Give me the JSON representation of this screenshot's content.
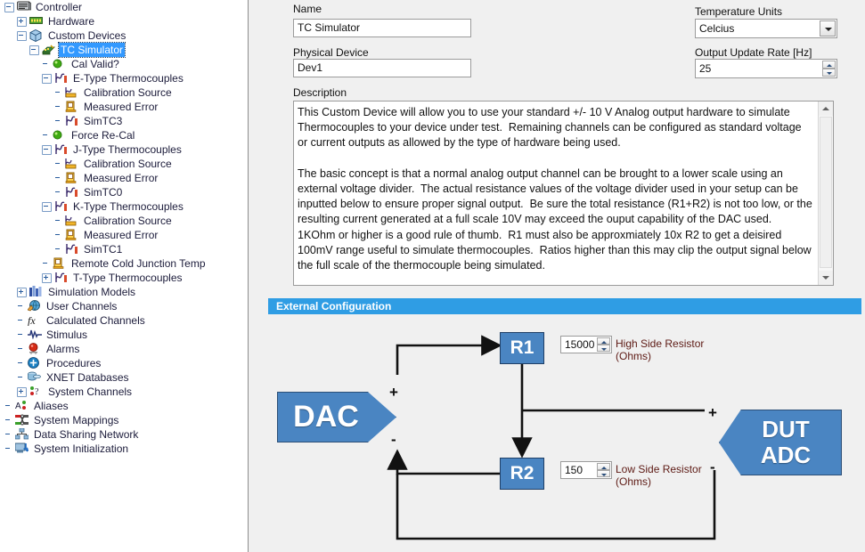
{
  "tree": {
    "items": [
      {
        "label": "Controller",
        "depth": 0,
        "toggle": "minus",
        "icon": "controller-icon",
        "selected": false
      },
      {
        "label": "Hardware",
        "depth": 1,
        "toggle": "plus",
        "icon": "hardware-icon",
        "selected": false
      },
      {
        "label": "Custom Devices",
        "depth": 1,
        "toggle": "minus",
        "icon": "custom-devices-icon",
        "selected": false
      },
      {
        "label": "TC Simulator",
        "depth": 2,
        "toggle": "minus",
        "icon": "tc-simulator-icon",
        "selected": true
      },
      {
        "label": "Cal Valid?",
        "depth": 3,
        "toggle": "none",
        "icon": "green-led-icon",
        "selected": false
      },
      {
        "label": "E-Type Thermocouples",
        "depth": 3,
        "toggle": "minus",
        "icon": "waveform-icon",
        "selected": false
      },
      {
        "label": "Calibration Source",
        "depth": 4,
        "toggle": "none",
        "icon": "calibration-source-icon",
        "selected": false
      },
      {
        "label": "Measured Error",
        "depth": 4,
        "toggle": "none",
        "icon": "measured-error-icon",
        "selected": false
      },
      {
        "label": "SimTC3",
        "depth": 4,
        "toggle": "none",
        "icon": "waveform-icon",
        "selected": false
      },
      {
        "label": "Force Re-Cal",
        "depth": 3,
        "toggle": "none",
        "icon": "green-led-icon",
        "selected": false
      },
      {
        "label": "J-Type Thermocouples",
        "depth": 3,
        "toggle": "minus",
        "icon": "waveform-icon",
        "selected": false
      },
      {
        "label": "Calibration Source",
        "depth": 4,
        "toggle": "none",
        "icon": "calibration-source-icon",
        "selected": false
      },
      {
        "label": "Measured Error",
        "depth": 4,
        "toggle": "none",
        "icon": "measured-error-icon",
        "selected": false
      },
      {
        "label": "SimTC0",
        "depth": 4,
        "toggle": "none",
        "icon": "waveform-icon",
        "selected": false
      },
      {
        "label": "K-Type Thermocouples",
        "depth": 3,
        "toggle": "minus",
        "icon": "waveform-icon",
        "selected": false
      },
      {
        "label": "Calibration Source",
        "depth": 4,
        "toggle": "none",
        "icon": "calibration-source-icon",
        "selected": false
      },
      {
        "label": "Measured Error",
        "depth": 4,
        "toggle": "none",
        "icon": "measured-error-icon",
        "selected": false
      },
      {
        "label": "SimTC1",
        "depth": 4,
        "toggle": "none",
        "icon": "waveform-icon",
        "selected": false
      },
      {
        "label": "Remote Cold Junction Temp",
        "depth": 3,
        "toggle": "none",
        "icon": "measured-error-icon",
        "selected": false
      },
      {
        "label": "T-Type Thermocouples",
        "depth": 3,
        "toggle": "plus",
        "icon": "waveform-icon",
        "selected": false
      },
      {
        "label": "Simulation Models",
        "depth": 1,
        "toggle": "plus",
        "icon": "simulation-models-icon",
        "selected": false
      },
      {
        "label": "User Channels",
        "depth": 1,
        "toggle": "none",
        "icon": "user-channels-icon",
        "selected": false
      },
      {
        "label": "Calculated Channels",
        "depth": 1,
        "toggle": "none",
        "icon": "calculated-channels-icon",
        "selected": false
      },
      {
        "label": "Stimulus",
        "depth": 1,
        "toggle": "none",
        "icon": "stimulus-icon",
        "selected": false
      },
      {
        "label": "Alarms",
        "depth": 1,
        "toggle": "none",
        "icon": "alarms-icon",
        "selected": false
      },
      {
        "label": "Procedures",
        "depth": 1,
        "toggle": "none",
        "icon": "procedures-icon",
        "selected": false
      },
      {
        "label": "XNET Databases",
        "depth": 1,
        "toggle": "none",
        "icon": "xnet-databases-icon",
        "selected": false
      },
      {
        "label": "System Channels",
        "depth": 1,
        "toggle": "plus",
        "icon": "system-channels-icon",
        "selected": false
      },
      {
        "label": "Aliases",
        "depth": 0,
        "toggle": "none",
        "icon": "aliases-icon",
        "selected": false
      },
      {
        "label": "System Mappings",
        "depth": 0,
        "toggle": "none",
        "icon": "system-mappings-icon",
        "selected": false
      },
      {
        "label": "Data Sharing Network",
        "depth": 0,
        "toggle": "none",
        "icon": "data-sharing-network-icon",
        "selected": false
      },
      {
        "label": "System Initialization",
        "depth": 0,
        "toggle": "none",
        "icon": "system-initialization-icon",
        "selected": false
      }
    ]
  },
  "form": {
    "name_label": "Name",
    "name_value": "TC Simulator",
    "physical_device_label": "Physical Device",
    "physical_device_value": "Dev1",
    "description_label": "Description",
    "temperature_units_label": "Temperature Units",
    "temperature_units_value": "Celcius",
    "output_update_rate_label": "Output Update Rate [Hz]",
    "output_update_rate_value": "25",
    "description_text": "This Custom Device will allow you to use your standard +/- 10 V Analog output hardware to simulate Thermocouples to your device under test.  Remaining channels can be configured as standard voltage or current outputs as allowed by the type of hardware being used.\n\nThe basic concept is that a normal analog output channel can be brought to a lower scale using an external voltage divider.  The actual resistance values of the voltage divider used in your setup can be inputted below to ensure proper signal output.  Be sure the total resistance (R1+R2) is not too low, or the resulting current generated at a full scale 10V may exceed the ouput capability of the DAC used.  1KOhm or higher is a good rule of thumb.  R1 must also be approxmiately 10x R2 to get a deisired 100mV range useful to simulate thermocouples.  Ratios higher than this may clip the output signal below the full scale of the thermocouple being simulated.\n\nSimulated TC values will be updated at the fixed rate designated by Output Update Rate."
  },
  "external_configuration": {
    "header": "External Configuration",
    "dac_label": "DAC",
    "dut_adc_label": "DUT\nADC",
    "dut_adc_line1": "DUT",
    "dut_adc_line2": "ADC",
    "r1_label": "R1",
    "r2_label": "R2",
    "r1_value": "15000",
    "r1_caption_line1": "High Side Resistor",
    "r1_caption_line2": "(Ohms)",
    "r2_value": "150",
    "r2_caption_line1": "Low Side Resistor",
    "r2_caption_line2": "(Ohms)",
    "dac_plus": "+",
    "dac_minus": "-",
    "adc_plus": "+",
    "adc_minus": "-"
  },
  "colors": {
    "section_header_bg": "#2f9de4",
    "selection_bg": "#3399ff",
    "resistor_fill": "#4a85c2",
    "shape_fill": "#4a85c2",
    "caption_text": "#5d1a14",
    "panel_bg": "#f0f0f0"
  }
}
